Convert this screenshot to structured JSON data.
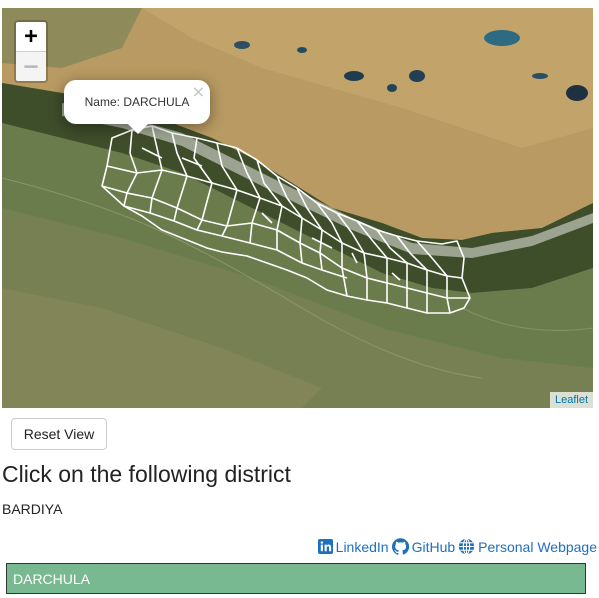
{
  "map": {
    "zoom_in_label": "+",
    "zoom_out_label": "—",
    "popup": {
      "text": "Name: DARCHULA",
      "close_label": "×"
    },
    "attribution": "Leaflet"
  },
  "controls": {
    "reset_label": "Reset View"
  },
  "quiz": {
    "heading": "Click on the following district",
    "target_district": "BARDIYA"
  },
  "links": {
    "linkedin_label": "LinkedIn",
    "linkedin_icon": "linkedin-icon",
    "github_label": "GitHub",
    "github_icon": "github-icon",
    "webpage_label": "Personal Webpage",
    "webpage_icon": "globe-icon"
  },
  "answer": {
    "text": "DARCHULA",
    "color": "#79b992"
  },
  "colors": {
    "boundary": "#ffffff",
    "link": "#1f6fbf"
  }
}
